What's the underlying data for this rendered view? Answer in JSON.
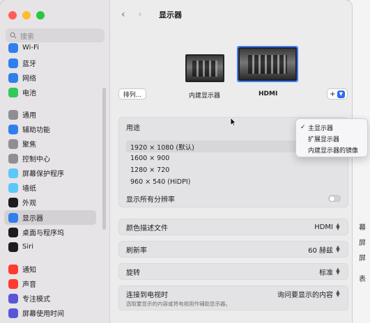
{
  "window": {
    "title": "显示器"
  },
  "sidebar": {
    "search_placeholder": "搜索",
    "items": [
      {
        "label": "Wi-Fi",
        "icon": "wifi-icon",
        "color": "#2f80ed"
      },
      {
        "label": "蓝牙",
        "icon": "bluetooth-icon",
        "color": "#2f80ed"
      },
      {
        "label": "网络",
        "icon": "network-icon",
        "color": "#2f80ed"
      },
      {
        "label": "电池",
        "icon": "battery-icon",
        "color": "#34c759"
      },
      {
        "label": "通用",
        "icon": "gear-icon",
        "color": "#8e8e93"
      },
      {
        "label": "辅助功能",
        "icon": "accessibility-icon",
        "color": "#2f80ed"
      },
      {
        "label": "聚焦",
        "icon": "spotlight-icon",
        "color": "#8e8e93"
      },
      {
        "label": "控制中心",
        "icon": "control-center-icon",
        "color": "#8e8e93"
      },
      {
        "label": "屏幕保护程序",
        "icon": "screensaver-icon",
        "color": "#5ac8fa"
      },
      {
        "label": "墙纸",
        "icon": "wallpaper-icon",
        "color": "#5ac8fa"
      },
      {
        "label": "外观",
        "icon": "appearance-icon",
        "color": "#1d1d1f"
      },
      {
        "label": "显示器",
        "icon": "display-icon",
        "color": "#2f80ed"
      },
      {
        "label": "桌面与程序坞",
        "icon": "dock-icon",
        "color": "#1d1d1f"
      },
      {
        "label": "Siri",
        "icon": "siri-icon",
        "color": "#1d1d1f"
      },
      {
        "label": "通知",
        "icon": "notifications-icon",
        "color": "#ff3b30"
      },
      {
        "label": "声音",
        "icon": "sound-icon",
        "color": "#ff3b30"
      },
      {
        "label": "专注模式",
        "icon": "focus-icon",
        "color": "#5856d6"
      },
      {
        "label": "屏幕使用时间",
        "icon": "screen-time-icon",
        "color": "#5856d6"
      }
    ],
    "active_index": 11
  },
  "toolbar": {
    "back": "‹",
    "forward": "›"
  },
  "displays": {
    "arrange_label": "排列...",
    "builtin_label": "内建显示器",
    "hdmi_label": "HDMI",
    "add_label": "+"
  },
  "settings": {
    "usage_label": "用途",
    "resolutions": [
      "1920 × 1080 (默认)",
      "1600 × 900",
      "1280 × 720",
      "960 × 540 (HiDPI)"
    ],
    "show_all_label": "显示所有分辨率",
    "color_profile_label": "颜色描述文件",
    "color_profile_value": "HDMI",
    "refresh_label": "刷新率",
    "refresh_value": "60 赫兹",
    "rotation_label": "旋转",
    "rotation_value": "标准",
    "tv_label": "连接到电视时",
    "tv_sub": "选取要显示的内容或将电视用作辅助显示器。",
    "tv_value": "询问要显示的内容"
  },
  "popup": {
    "items": [
      "主显示器",
      "扩展显示器",
      "内建显示器的镜像"
    ],
    "checked_index": 0
  },
  "background_window": {
    "lines": [
      "幕",
      "屏",
      "屏",
      "表"
    ]
  }
}
